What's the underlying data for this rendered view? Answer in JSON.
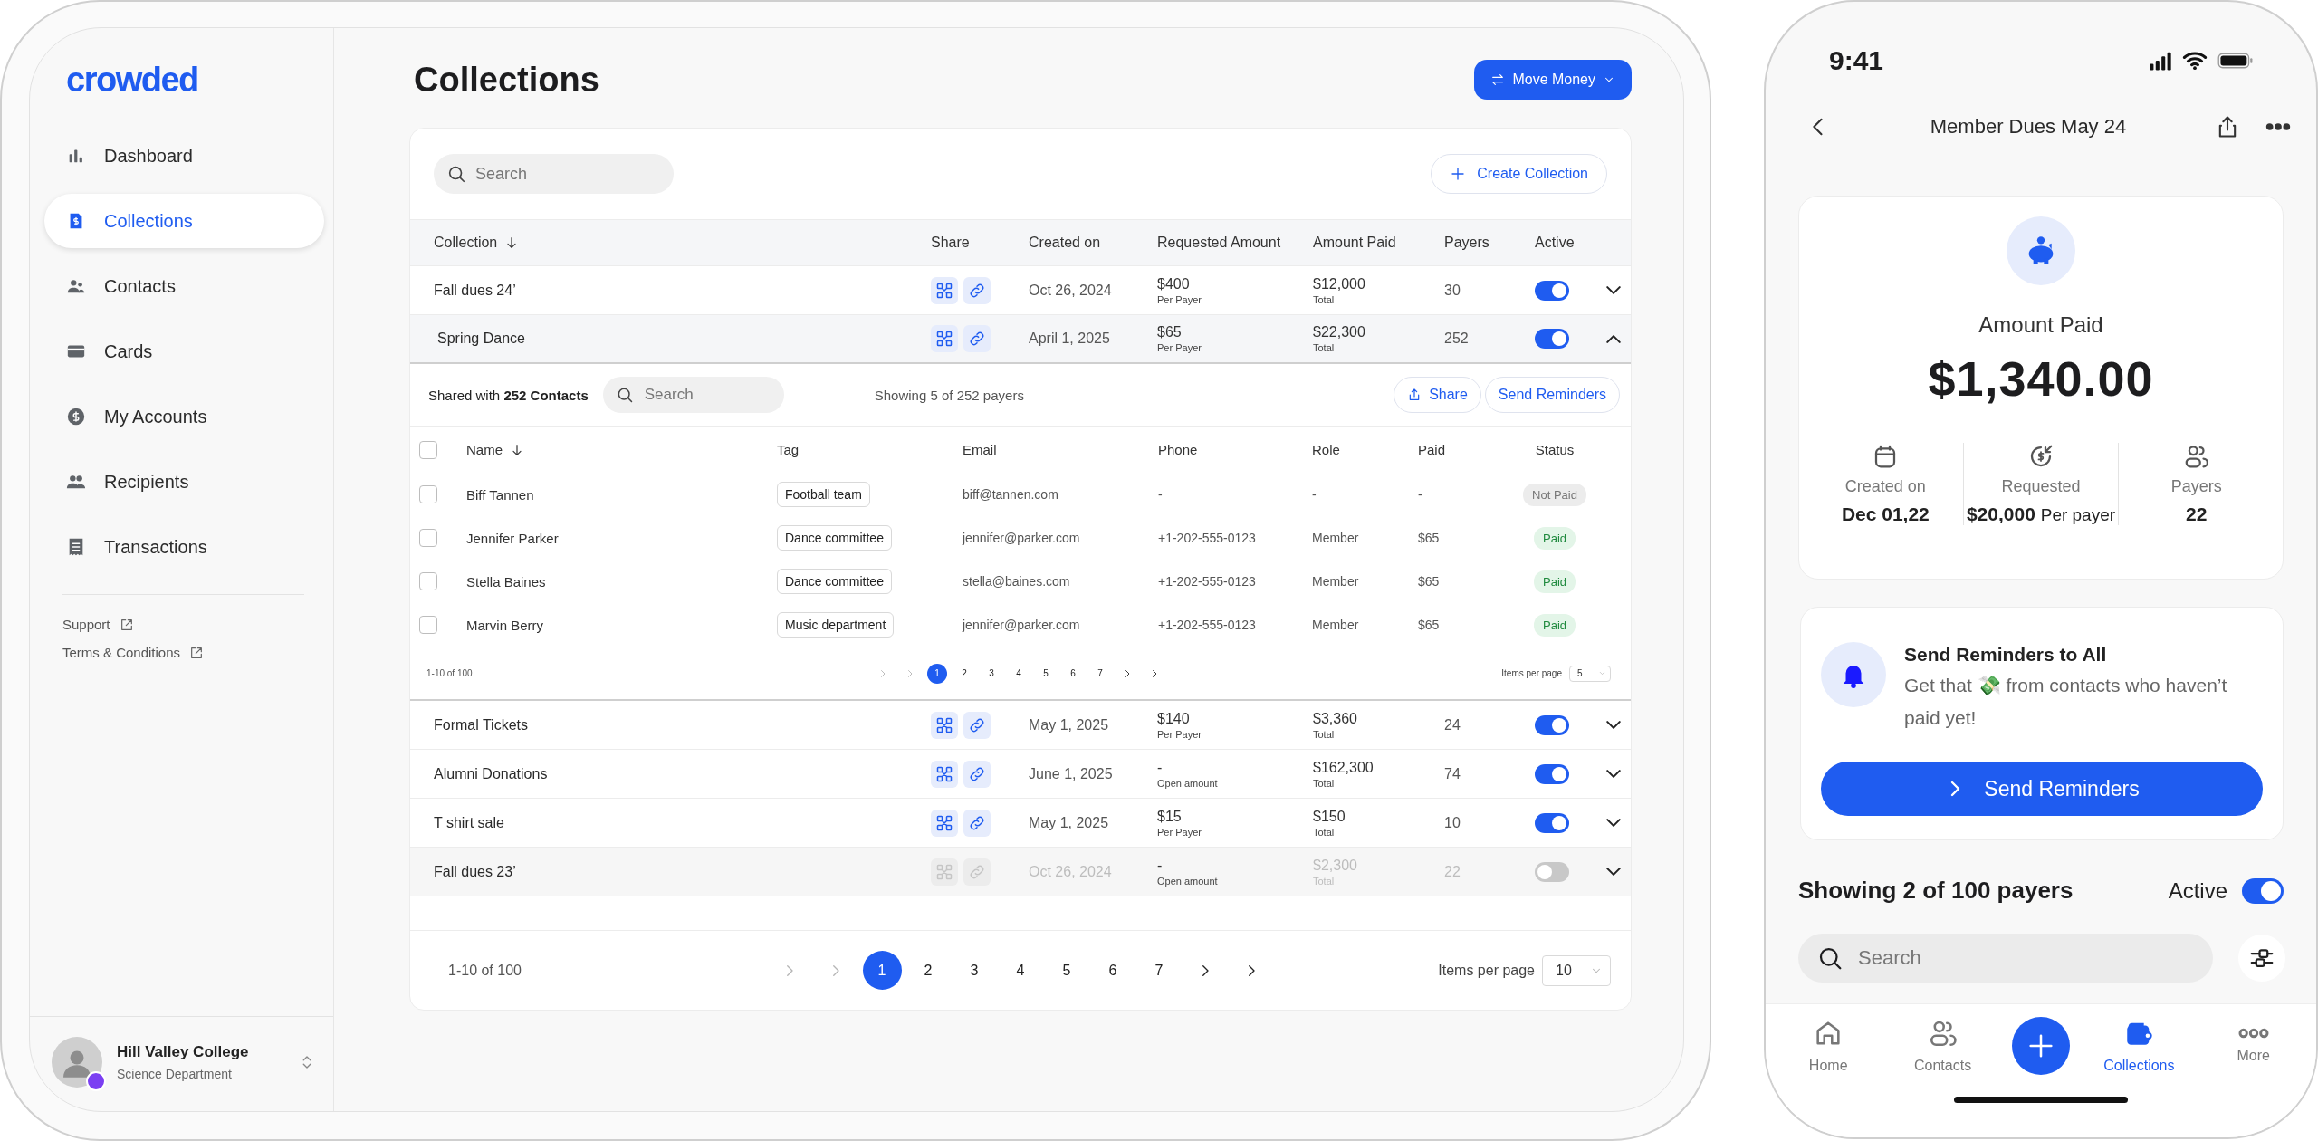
{
  "sidebar": {
    "logo": "crowded",
    "items": [
      {
        "label": "Dashboard",
        "selected": false
      },
      {
        "label": "Collections",
        "selected": true
      },
      {
        "label": "Contacts",
        "selected": false
      },
      {
        "label": "Cards",
        "selected": false
      },
      {
        "label": "My Accounts",
        "selected": false
      },
      {
        "label": "Recipients",
        "selected": false
      },
      {
        "label": "Transactions",
        "selected": false
      }
    ],
    "links": [
      "Support",
      "Terms & Conditions"
    ],
    "account": {
      "name": "Hill Valley College",
      "department": "Science Department"
    }
  },
  "page": {
    "title": "Collections",
    "action": "Move Money"
  },
  "collections": {
    "search": {
      "placeholder": "Search"
    },
    "create": "Create Collection",
    "columns": [
      "Collection",
      "Share",
      "Created on",
      "Requested Amount",
      "Amount Paid",
      "Payers",
      "Active"
    ],
    "rows": [
      {
        "name": "Fall dues 24’",
        "created": "Oct 26, 2024",
        "requested": "$400",
        "requested_note": "Per Payer",
        "paid": "$12,000",
        "paid_note": "Total",
        "payers": "30",
        "active": true,
        "expanded": false
      },
      {
        "name": "Spring Dance",
        "created": "April 1, 2025",
        "requested": "$65",
        "requested_note": "Per Payer",
        "paid": "$22,300",
        "paid_note": "Total",
        "payers": "252",
        "active": true,
        "expanded": true,
        "detail": {
          "shared": "Shared with **252 Contacts**",
          "search": {
            "placeholder": "Search"
          },
          "showing": "Showing 5 of 252 payers",
          "share": "Share",
          "remind": "Send Reminders",
          "all_checked": false,
          "columns": [
            "Name",
            "Tag",
            "Email",
            "Phone",
            "Role",
            "Paid",
            "Status"
          ],
          "rows": [
            {
              "name": "Biff Tannen",
              "tag": "Football team",
              "email": "biff@tannen.com",
              "phone": "-",
              "role": "-",
              "paid": "-",
              "status": "Not Paid",
              "settled": false,
              "checked": false
            },
            {
              "name": "Jennifer Parker",
              "tag": "Dance committee",
              "email": "jennifer@parker.com",
              "phone": "+1-202-555-0123",
              "role": "Member",
              "paid": "$65",
              "status": "Paid",
              "settled": true,
              "checked": false
            },
            {
              "name": "Stella Baines",
              "tag": "Dance committee",
              "email": "stella@baines.com",
              "phone": "+1-202-555-0123",
              "role": "Member",
              "paid": "$65",
              "status": "Paid",
              "settled": true,
              "checked": false
            },
            {
              "name": "Marvin Berry",
              "tag": "Music department",
              "email": "jennifer@parker.com",
              "phone": "+1-202-555-0123",
              "role": "Member",
              "paid": "$65",
              "status": "Paid",
              "settled": true,
              "checked": false
            }
          ],
          "pagination": {
            "range": "1-10 of 100",
            "pages": [
              {
                "label": "1",
                "selected": true
              },
              {
                "label": "2",
                "selected": false
              },
              {
                "label": "3",
                "selected": false
              },
              {
                "label": "4",
                "selected": false
              },
              {
                "label": "5",
                "selected": false
              },
              {
                "label": "6",
                "selected": false
              },
              {
                "label": "7",
                "selected": false
              }
            ],
            "items_label": "Items per page",
            "items_value": "5"
          }
        }
      },
      {
        "name": "Formal Tickets",
        "created": "May 1, 2025",
        "requested": "$140",
        "requested_note": "Per Payer",
        "paid": "$3,360",
        "paid_note": "Total",
        "payers": "24",
        "active": true,
        "expanded": false
      },
      {
        "name": "Alumni Donations",
        "created": "June 1, 2025",
        "requested": "-",
        "requested_note": "Open amount",
        "paid": "$162,300",
        "paid_note": "Total",
        "payers": "74",
        "active": true,
        "expanded": false
      },
      {
        "name": "T shirt sale",
        "created": "May 1, 2025",
        "requested": "$15",
        "requested_note": "Per Payer",
        "paid": "$150",
        "paid_note": "Total",
        "payers": "10",
        "active": true,
        "expanded": false
      },
      {
        "name": "Fall dues 23’",
        "created": "Oct 26, 2024",
        "requested": "-",
        "requested_note": "Open amount",
        "paid": "$2,300",
        "paid_note": "Total",
        "payers": "22",
        "active": false,
        "expanded": false
      }
    ],
    "pagination": {
      "range": "1-10 of 100",
      "pages": [
        {
          "label": "1",
          "selected": true
        },
        {
          "label": "2",
          "selected": false
        },
        {
          "label": "3",
          "selected": false
        },
        {
          "label": "4",
          "selected": false
        },
        {
          "label": "5",
          "selected": false
        },
        {
          "label": "6",
          "selected": false
        },
        {
          "label": "7",
          "selected": false
        }
      ],
      "items_label": "Items per page",
      "items_value": "10"
    }
  },
  "phone": {
    "time": "9:41",
    "title": "Member Dues May 24",
    "summary": {
      "label": "Amount Paid",
      "amount": "$1,340.00",
      "stats": [
        {
          "label": "Created on",
          "value": "Dec 01,22"
        },
        {
          "label": "Requested",
          "value": "$20,000",
          "suffix": "Per payer"
        },
        {
          "label": "Payers",
          "value": "22"
        }
      ]
    },
    "reminder": {
      "title": "Send Reminders to All",
      "text": "Get that 💸 from contacts who haven’t paid yet!",
      "button": "Send Reminders"
    },
    "list": {
      "showing": "Showing 2 of 100 payers",
      "active_label": "Active",
      "active": true,
      "search": {
        "placeholder": "Search"
      }
    },
    "tabs": [
      {
        "label": "Home",
        "selected": false
      },
      {
        "label": "Contacts",
        "selected": false
      },
      {
        "label": "Collections",
        "selected": true
      },
      {
        "label": "More",
        "selected": false
      }
    ]
  }
}
